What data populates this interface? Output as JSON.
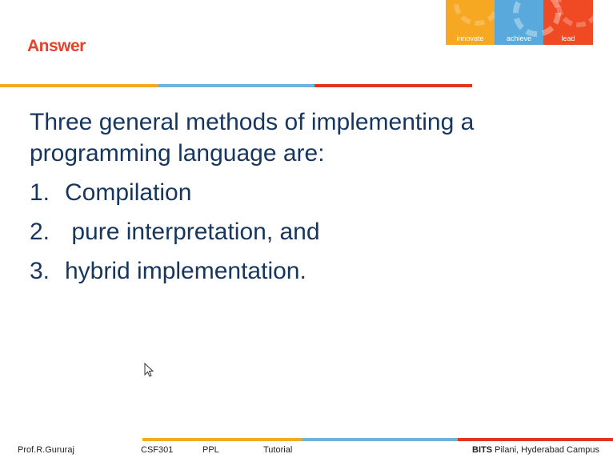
{
  "slide": {
    "title": "Answer",
    "intro": "Three general methods of implementing a programming language are:",
    "items": [
      {
        "number": "1.",
        "text": "Compilation"
      },
      {
        "number": "2.",
        "text": " pure interpretation, and"
      },
      {
        "number": "3.",
        "text": "hybrid implementation."
      }
    ]
  },
  "logo": {
    "segments": [
      "innovate",
      "achieve",
      "lead"
    ]
  },
  "footer": {
    "author": "Prof.R.Gururaj",
    "course_code": "CSF301",
    "course_name": "PPL",
    "session": "Tutorial",
    "institution_bold": "BITS",
    "institution_rest": " Pilani, Hyderabad Campus"
  },
  "colors": {
    "title": "#e8402a",
    "body_text": "#17365d",
    "orange": "#f7a823",
    "blue": "#6fb3dd",
    "red": "#e2341e",
    "logo_orange": "#f7a823",
    "logo_blue": "#5aa9dc",
    "logo_red": "#ef4a23"
  }
}
